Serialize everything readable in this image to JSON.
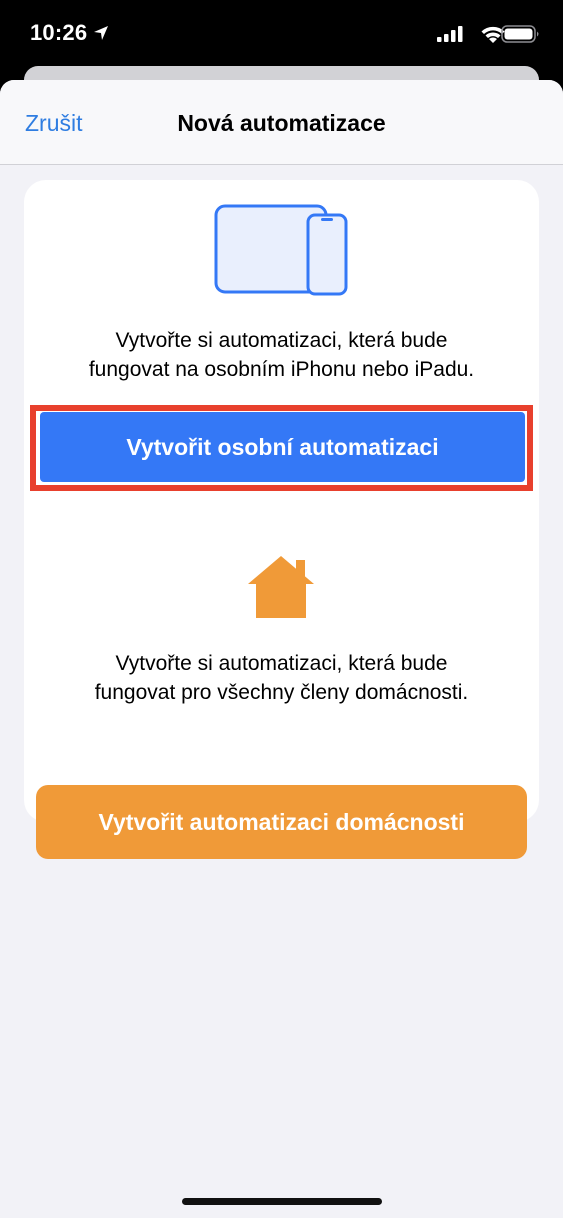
{
  "status_bar": {
    "time": "10:26",
    "icons": [
      "location-arrow-icon",
      "cellular-signal-icon",
      "wifi-icon",
      "battery-icon"
    ]
  },
  "nav": {
    "cancel_label": "Zrušit",
    "title": "Nová automatizace"
  },
  "personal": {
    "icon": "devices-icon",
    "description_line1": "Vytvořte si automatizaci, která bude",
    "description_line2": "fungovat na osobním iPhonu nebo iPadu.",
    "button_label": "Vytvořit osobní automatizaci"
  },
  "home": {
    "icon": "house-icon",
    "description_line1": "Vytvořte si automatizaci, která bude",
    "description_line2": "fungovat pro všechny členy domácnosti.",
    "button_label": "Vytvořit automatizaci domácnosti"
  },
  "colors": {
    "accent_blue": "#3478f6",
    "link_blue": "#2f7de1",
    "home_orange": "#f09a38",
    "highlight_red": "#e8402d",
    "background": "#f2f2f7"
  }
}
